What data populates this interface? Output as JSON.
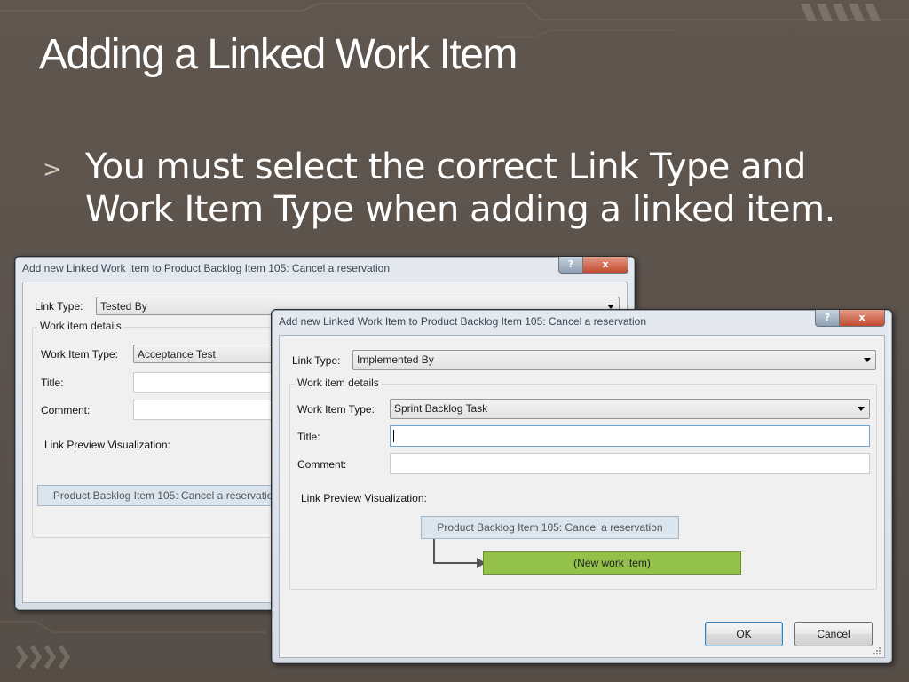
{
  "slide": {
    "title": "Adding a Linked Work Item",
    "bullet_marker": ">",
    "bullet_text": "You must select the correct Link Type and Work Item Type when adding a linked item.",
    "colors": {
      "background": "#5c534c",
      "title": "#ffffff",
      "accent": "#d8c8b4"
    }
  },
  "dialog_back": {
    "title": "Add new Linked Work Item to Product Backlog Item 105: Cancel a reservation",
    "help_label": "?",
    "close_label": "x",
    "link_type_label": "Link Type:",
    "link_type_value": "Tested By",
    "group_caption": "Work item details",
    "work_item_type_label": "Work Item Type:",
    "work_item_type_value": "Acceptance Test",
    "title_label": "Title:",
    "comment_label": "Comment:",
    "preview_label": "Link Preview Visualization:",
    "parent_node": "Product Backlog Item 105: Cancel a reservation"
  },
  "dialog_front": {
    "title": "Add new Linked Work Item to Product Backlog Item 105: Cancel a reservation",
    "help_label": "?",
    "close_label": "x",
    "link_type_label": "Link Type:",
    "link_type_value": "Implemented By",
    "group_caption": "Work item details",
    "work_item_type_label": "Work Item Type:",
    "work_item_type_value": "Sprint Backlog Task",
    "title_label": "Title:",
    "title_value": "",
    "comment_label": "Comment:",
    "comment_value": "",
    "preview_label": "Link Preview Visualization:",
    "parent_node": "Product Backlog Item 105: Cancel a reservation",
    "new_node": "(New work item)",
    "ok_label": "OK",
    "cancel_label": "Cancel"
  }
}
